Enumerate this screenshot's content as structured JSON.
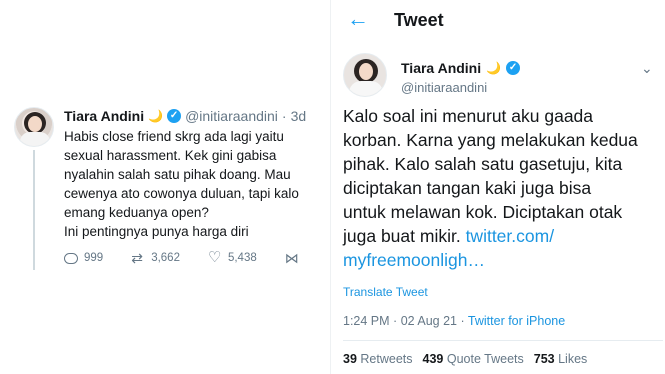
{
  "left": {
    "name": "Tiara Andini",
    "handle": "@initiaraandini",
    "dot": "·",
    "time": "3d",
    "lines": [
      "Habis close friend skrg ada lagi yaitu",
      "sexual harassment. Kek gini gabisa",
      "nyalahin salah satu pihak doang. Mau",
      "cewenya ato cowonya duluan, tapi kalo",
      "emang keduanya open?",
      "Ini pentingnya punya harga diri"
    ],
    "replies": "999",
    "retweets": "3,662",
    "likes": "5,438"
  },
  "right": {
    "header_title": "Tweet",
    "name": "Tiara Andini",
    "handle": "@initiaraandini",
    "lines": [
      "Kalo soal ini menurut aku gaada",
      "korban. Karna yang melakukan kedua",
      "pihak. Kalo salah satu gasetuju, kita",
      "diciptakan tangan kaki juga bisa",
      "untuk melawan kok. Diciptakan otak"
    ],
    "line6_text": "juga buat mikir. ",
    "line6_link": "twitter.com/",
    "line7_link": "myfreemoonligh…",
    "translate": "Translate Tweet",
    "time": "1:24 PM",
    "sep": "·",
    "date": "02 Aug 21",
    "source": "Twitter for iPhone",
    "retweets_count": "39",
    "retweets_label": "Retweets",
    "quotes_count": "439",
    "quotes_label": "Quote Tweets",
    "likes_count": "753",
    "likes_label": "Likes"
  },
  "icons": {
    "moon": "🌙",
    "verified": "✓",
    "back": "←",
    "chevron": "⌄"
  },
  "colors": {
    "accent": "#1da1f2",
    "link": "#1b95e0",
    "muted": "#657786",
    "text": "#14171a"
  }
}
